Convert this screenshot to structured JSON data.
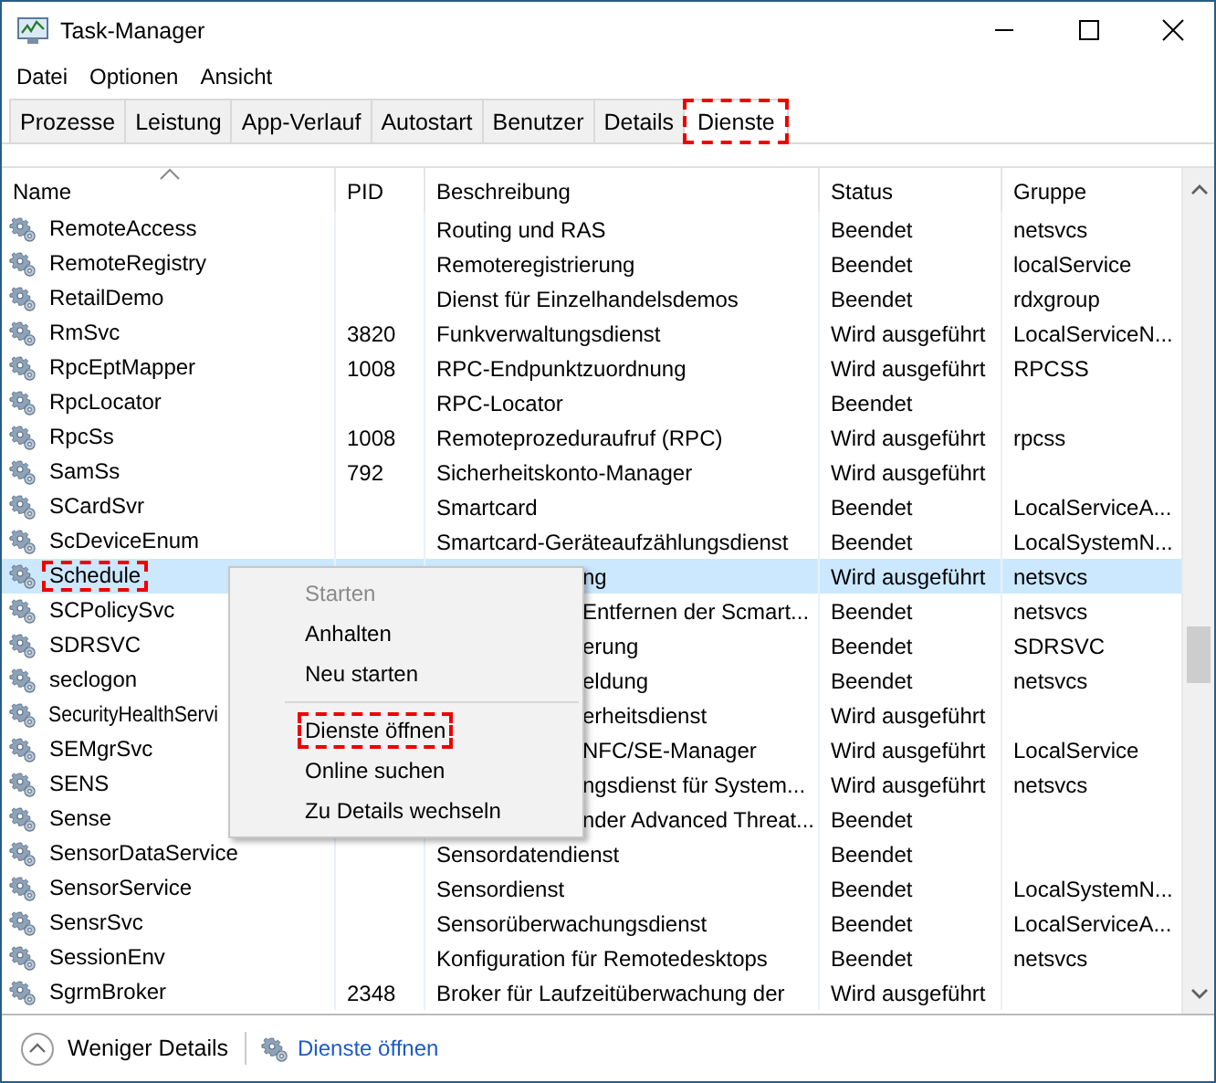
{
  "window": {
    "title": "Task-Manager"
  },
  "menu_bar": [
    "Datei",
    "Optionen",
    "Ansicht"
  ],
  "tabs": [
    {
      "label": "Prozesse",
      "selected": false,
      "annotated": false
    },
    {
      "label": "Leistung",
      "selected": false,
      "annotated": false
    },
    {
      "label": "App-Verlauf",
      "selected": false,
      "annotated": false
    },
    {
      "label": "Autostart",
      "selected": false,
      "annotated": false
    },
    {
      "label": "Benutzer",
      "selected": false,
      "annotated": false
    },
    {
      "label": "Details",
      "selected": false,
      "annotated": false
    },
    {
      "label": "Dienste",
      "selected": true,
      "annotated": true
    }
  ],
  "table": {
    "columns": [
      "Name",
      "PID",
      "Beschreibung",
      "Status",
      "Gruppe"
    ],
    "rows": [
      {
        "name": "RemoteAccess",
        "description": "Routing und RAS",
        "status": "Beendet",
        "group": "netsvcs",
        "selected": false,
        "annotated": false,
        "covered": false
      },
      {
        "name": "RemoteRegistry",
        "description": "Remoteregistrierung",
        "status": "Beendet",
        "group": "localService",
        "selected": false,
        "annotated": false,
        "covered": false
      },
      {
        "name": "RetailDemo",
        "description": "Dienst für Einzelhandelsdemos",
        "status": "Beendet",
        "group": "rdxgroup",
        "selected": false,
        "annotated": false,
        "covered": false
      },
      {
        "name": "RmSvc",
        "pid": "3820",
        "description": "Funkverwaltungsdienst",
        "status": "Wird ausgeführt",
        "group": "LocalServiceN...",
        "selected": false,
        "annotated": false,
        "covered": false
      },
      {
        "name": "RpcEptMapper",
        "pid": "1008",
        "description": "RPC-Endpunktzuordnung",
        "status": "Wird ausgeführt",
        "group": "RPCSS",
        "selected": false,
        "annotated": false,
        "covered": false
      },
      {
        "name": "RpcLocator",
        "description": "RPC-Locator",
        "status": "Beendet",
        "selected": false,
        "annotated": false,
        "covered": false
      },
      {
        "name": "RpcSs",
        "pid": "1008",
        "description": "Remoteprozeduraufruf (RPC)",
        "status": "Wird ausgeführt",
        "group": "rpcss",
        "selected": false,
        "annotated": false,
        "covered": false
      },
      {
        "name": "SamSs",
        "pid": "792",
        "description": "Sicherheitskonto-Manager",
        "status": "Wird ausgeführt",
        "selected": false,
        "annotated": false,
        "covered": false
      },
      {
        "name": "SCardSvr",
        "description": "Smartcard",
        "status": "Beendet",
        "group": "LocalServiceA...",
        "selected": false,
        "annotated": false,
        "covered": false
      },
      {
        "name": "ScDeviceEnum",
        "description": "Smartcard-Geräteaufzählungsdienst",
        "status": "Beendet",
        "group": "LocalSystemN...",
        "selected": false,
        "annotated": false,
        "covered": false
      },
      {
        "name": "Schedule",
        "description": "ng",
        "status": "Wird ausgeführt",
        "group": "netsvcs",
        "selected": true,
        "annotated": true,
        "covered": true
      },
      {
        "name": "SCPolicySvc",
        "description": "Entfernen der Scmart...",
        "status": "Beendet",
        "group": "netsvcs",
        "selected": false,
        "annotated": false,
        "covered": true
      },
      {
        "name": "SDRSVC",
        "description": "erung",
        "status": "Beendet",
        "group": "SDRSVC",
        "selected": false,
        "annotated": false,
        "covered": true
      },
      {
        "name": "seclogon",
        "description": "eldung",
        "status": "Beendet",
        "group": "netsvcs",
        "selected": false,
        "annotated": false,
        "covered": true
      },
      {
        "name": "SecurityHealthServi",
        "description": "erheitsdienst",
        "status": "Wird ausgeführt",
        "selected": false,
        "annotated": false,
        "covered": true
      },
      {
        "name": "SEMgrSvc",
        "description": "NFC/SE-Manager",
        "status": "Wird ausgeführt",
        "group": "LocalService",
        "selected": false,
        "annotated": false,
        "covered": true
      },
      {
        "name": "SENS",
        "description": "ngsdienst für System...",
        "status": "Wird ausgeführt",
        "group": "netsvcs",
        "selected": false,
        "annotated": false,
        "covered": true
      },
      {
        "name": "Sense",
        "description": "nder Advanced Threat...",
        "status": "Beendet",
        "selected": false,
        "annotated": false,
        "covered": true
      },
      {
        "name": "SensorDataService",
        "description": "Sensordatendienst",
        "status": "Beendet",
        "selected": false,
        "annotated": false,
        "covered": false
      },
      {
        "name": "SensorService",
        "description": "Sensordienst",
        "status": "Beendet",
        "group": "LocalSystemN...",
        "selected": false,
        "annotated": false,
        "covered": false
      },
      {
        "name": "SensrSvc",
        "description": "Sensorüberwachungsdienst",
        "status": "Beendet",
        "group": "LocalServiceA...",
        "selected": false,
        "annotated": false,
        "covered": false
      },
      {
        "name": "SessionEnv",
        "description": "Konfiguration für Remotedesktops",
        "status": "Beendet",
        "group": "netsvcs",
        "selected": false,
        "annotated": false,
        "covered": false
      },
      {
        "name": "SgrmBroker",
        "pid": "2348",
        "description": "Broker für Laufzeitüberwachung der",
        "status": "Wird ausgeführt",
        "selected": false,
        "annotated": false,
        "covered": false
      }
    ]
  },
  "context_menu": [
    {
      "kind": "item",
      "label": "Starten",
      "disabled": true,
      "annotated": false
    },
    {
      "kind": "item",
      "label": "Anhalten",
      "disabled": false,
      "annotated": false
    },
    {
      "kind": "item",
      "label": "Neu starten",
      "disabled": false,
      "annotated": false
    },
    {
      "kind": "separator"
    },
    {
      "kind": "item",
      "label": "Dienste öffnen",
      "disabled": false,
      "annotated": true
    },
    {
      "kind": "item",
      "label": "Online suchen",
      "disabled": false,
      "annotated": false
    },
    {
      "kind": "item",
      "label": "Zu Details wechseln",
      "disabled": false,
      "annotated": false
    }
  ],
  "footer": {
    "less_details": "Weniger Details",
    "open_services": "Dienste öffnen"
  }
}
